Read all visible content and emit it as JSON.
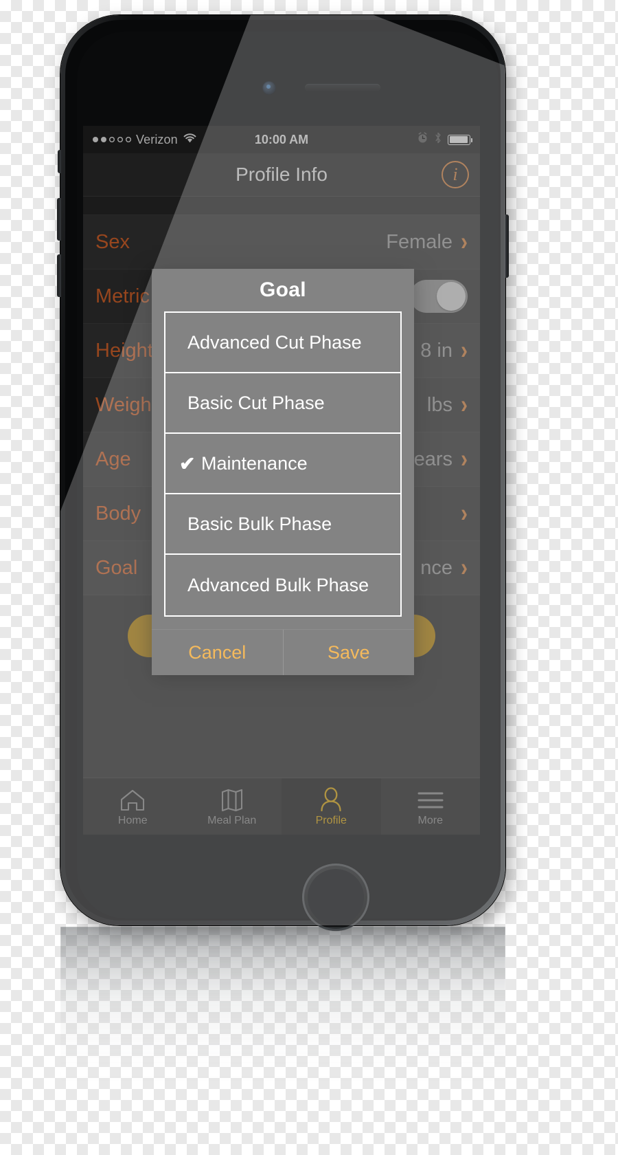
{
  "status_bar": {
    "signal_dots_filled": 2,
    "signal_dots_total": 5,
    "carrier": "Verizon",
    "wifi_icon": "wifi-icon",
    "time": "10:00 AM",
    "alarm_icon": "alarm-clock-icon",
    "bluetooth_icon": "bluetooth-icon",
    "battery_icon": "battery-icon"
  },
  "nav": {
    "title": "Profile Info",
    "info_button_label": "i",
    "info_button_color": "#d2803f"
  },
  "list": {
    "rows": [
      {
        "label": "Sex",
        "value": "Female",
        "accessory": "chevron"
      },
      {
        "label": "Metric",
        "value": "",
        "accessory": "toggle"
      },
      {
        "label": "Height",
        "value": "8 in",
        "accessory": "chevron"
      },
      {
        "label": "Weight",
        "value": "lbs",
        "accessory": "chevron"
      },
      {
        "label": "Age",
        "value": "ears",
        "accessory": "chevron"
      },
      {
        "label": "Body",
        "value": "",
        "accessory": "chevron"
      },
      {
        "label": "Goal",
        "value": "nce",
        "accessory": "chevron"
      }
    ],
    "label_color": "#d2622a",
    "value_color": "#9a9a9a"
  },
  "primary_button": {
    "label": "",
    "color": "#b8860b"
  },
  "tabbar": {
    "tabs": [
      {
        "label": "Home",
        "icon": "home-icon",
        "active": false
      },
      {
        "label": "Meal Plan",
        "icon": "map-icon",
        "active": false
      },
      {
        "label": "Profile",
        "icon": "person-icon",
        "active": true
      },
      {
        "label": "More",
        "icon": "menu-icon",
        "active": false
      }
    ],
    "active_color": "#d2a00b",
    "inactive_color": "#8a8a8a"
  },
  "modal": {
    "title": "Goal",
    "options": [
      {
        "label": "Advanced Cut Phase",
        "selected": false
      },
      {
        "label": "Basic Cut Phase",
        "selected": false
      },
      {
        "label": "Maintenance",
        "selected": true
      },
      {
        "label": "Basic Bulk Phase",
        "selected": false
      },
      {
        "label": "Advanced Bulk Phase",
        "selected": false
      }
    ],
    "checkmark": "✔",
    "cancel_label": "Cancel",
    "save_label": "Save",
    "action_color": "#f2a52a"
  }
}
